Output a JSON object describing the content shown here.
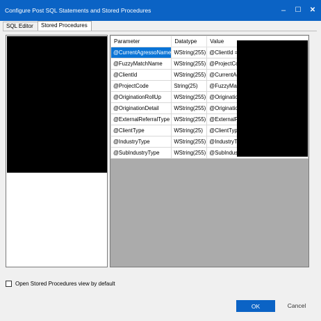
{
  "window": {
    "title": "Configure Post SQL Statements and Stored Procedures",
    "minimize_glyph": "–",
    "maximize_glyph": "☐",
    "close_glyph": "✕"
  },
  "tabs": [
    {
      "label": "SQL Editor",
      "selected": false
    },
    {
      "label": "Stored Procedures",
      "selected": true
    }
  ],
  "grid": {
    "columns": [
      "Parameter",
      "Datatype",
      "Value"
    ],
    "rows": [
      {
        "parameter": "@CurrentAgressoName",
        "datatype": "WString(255)",
        "value": "@ClientId =",
        "selected": true
      },
      {
        "parameter": "@FuzzyMatchName",
        "datatype": "WString(255)",
        "value": "@ProjectCo"
      },
      {
        "parameter": "@ClientId",
        "datatype": "WString(255)",
        "value": "@CurrentAg"
      },
      {
        "parameter": "@ProjectCode",
        "datatype": "String(25)",
        "value": "@FuzzyMatc"
      },
      {
        "parameter": "@OriginationRollUp",
        "datatype": "WString(255)",
        "value": "@Origination"
      },
      {
        "parameter": "@OriginationDetail",
        "datatype": "WString(255)",
        "value": "@Origination"
      },
      {
        "parameter": "@ExternalReferralType",
        "datatype": "WString(255)",
        "value": "@ExternalR"
      },
      {
        "parameter": "@ClientType",
        "datatype": "WString(25)",
        "value": "@ClientType"
      },
      {
        "parameter": "@IndustryType",
        "datatype": "WString(255)",
        "value": "@IndustryTy"
      },
      {
        "parameter": "@SubIndustryType",
        "datatype": "WString(255)",
        "value": "@SubIndust"
      }
    ]
  },
  "options": {
    "open_sp_default_label": "Open Stored Procedures view by default",
    "open_sp_default_checked": false
  },
  "buttons": {
    "ok": "OK",
    "cancel": "Cancel"
  },
  "colors": {
    "titlebar": "#0b63c5",
    "selection": "#0a74d6",
    "grid_empty": "#ababab",
    "redaction": "#000000"
  }
}
